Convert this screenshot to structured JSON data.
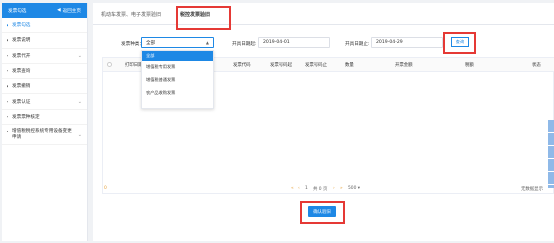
{
  "sidebar": {
    "title": "发票勾选",
    "back_label": "返回主页",
    "items": [
      {
        "label": "发票勾选",
        "active": true,
        "has_chevron": false
      },
      {
        "label": "发票说明",
        "active": false,
        "has_chevron": false
      },
      {
        "label": "发票代开",
        "active": false,
        "has_chevron": true
      },
      {
        "label": "发票查询",
        "active": false,
        "has_chevron": false
      },
      {
        "label": "发票撤销",
        "active": false,
        "has_chevron": false
      },
      {
        "label": "发票认证",
        "active": false,
        "has_chevron": true
      },
      {
        "label": "发票票种核定",
        "active": false,
        "has_chevron": false
      },
      {
        "label": "增值税税控系统专用设备变更申请",
        "active": false,
        "has_chevron": true
      }
    ]
  },
  "tabs": [
    {
      "label": "机动车发票、电子发票验旧",
      "active": false
    },
    {
      "label": "税控发票验旧",
      "active": true
    }
  ],
  "filters": {
    "invoice_type_label": "发票种类：",
    "invoice_type_value": "全部",
    "start_date_label": "开具日期起:",
    "start_date_value": "2019-04-01",
    "end_date_label": "开具日期止:",
    "end_date_value": "2019-04-29",
    "query_label": "查询"
  },
  "dropdown": {
    "options": [
      "全部",
      "增值税专用发票",
      "增值税普通发票",
      "农产品收购发票"
    ],
    "selected": "全部"
  },
  "table": {
    "headers": [
      "打印日期",
      "发票代码",
      "发票号码起",
      "发票号码止",
      "数量",
      "开票金额",
      "税额",
      "状态"
    ],
    "rows": []
  },
  "pager": {
    "left_text": "0",
    "first": "«",
    "prev": "‹",
    "page": "1",
    "total": "共 0 页",
    "next": "›",
    "last": "»",
    "page_size": "500 ▾",
    "no_data": "无数据显示"
  },
  "actions": {
    "confirm_label": "确认验旧"
  },
  "colors": {
    "brand": "#1e88e5",
    "highlight": "#e53935"
  }
}
